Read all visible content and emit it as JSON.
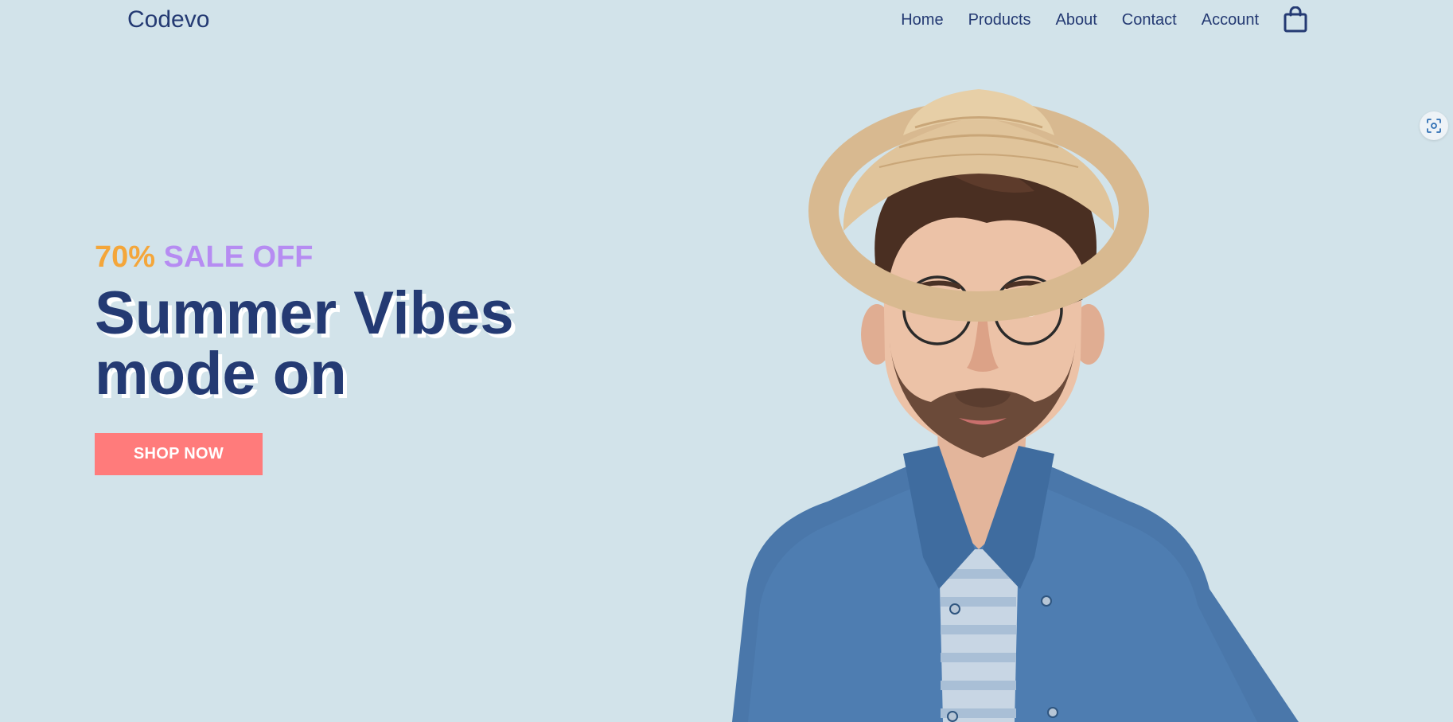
{
  "header": {
    "logo": "Codevo",
    "nav": [
      "Home",
      "Products",
      "About",
      "Contact",
      "Account"
    ],
    "cart_icon": "shopping-bag-icon"
  },
  "hero": {
    "sale_percent": "70%",
    "sale_text": "SALE OFF",
    "headline_line1": "Summer Vibes",
    "headline_line2": "mode on",
    "cta_label": "SHOP NOW",
    "image": "man-with-straw-hat-glasses-denim-shirt"
  },
  "floating_tool": {
    "icon": "screen-capture-icon"
  },
  "colors": {
    "background": "#d2e3ea",
    "primary_text": "#243a73",
    "sale_percent": "#f4a63a",
    "sale_text": "#b68cf2",
    "cta_background": "#ff7b7b",
    "cta_text": "#ffffff"
  }
}
